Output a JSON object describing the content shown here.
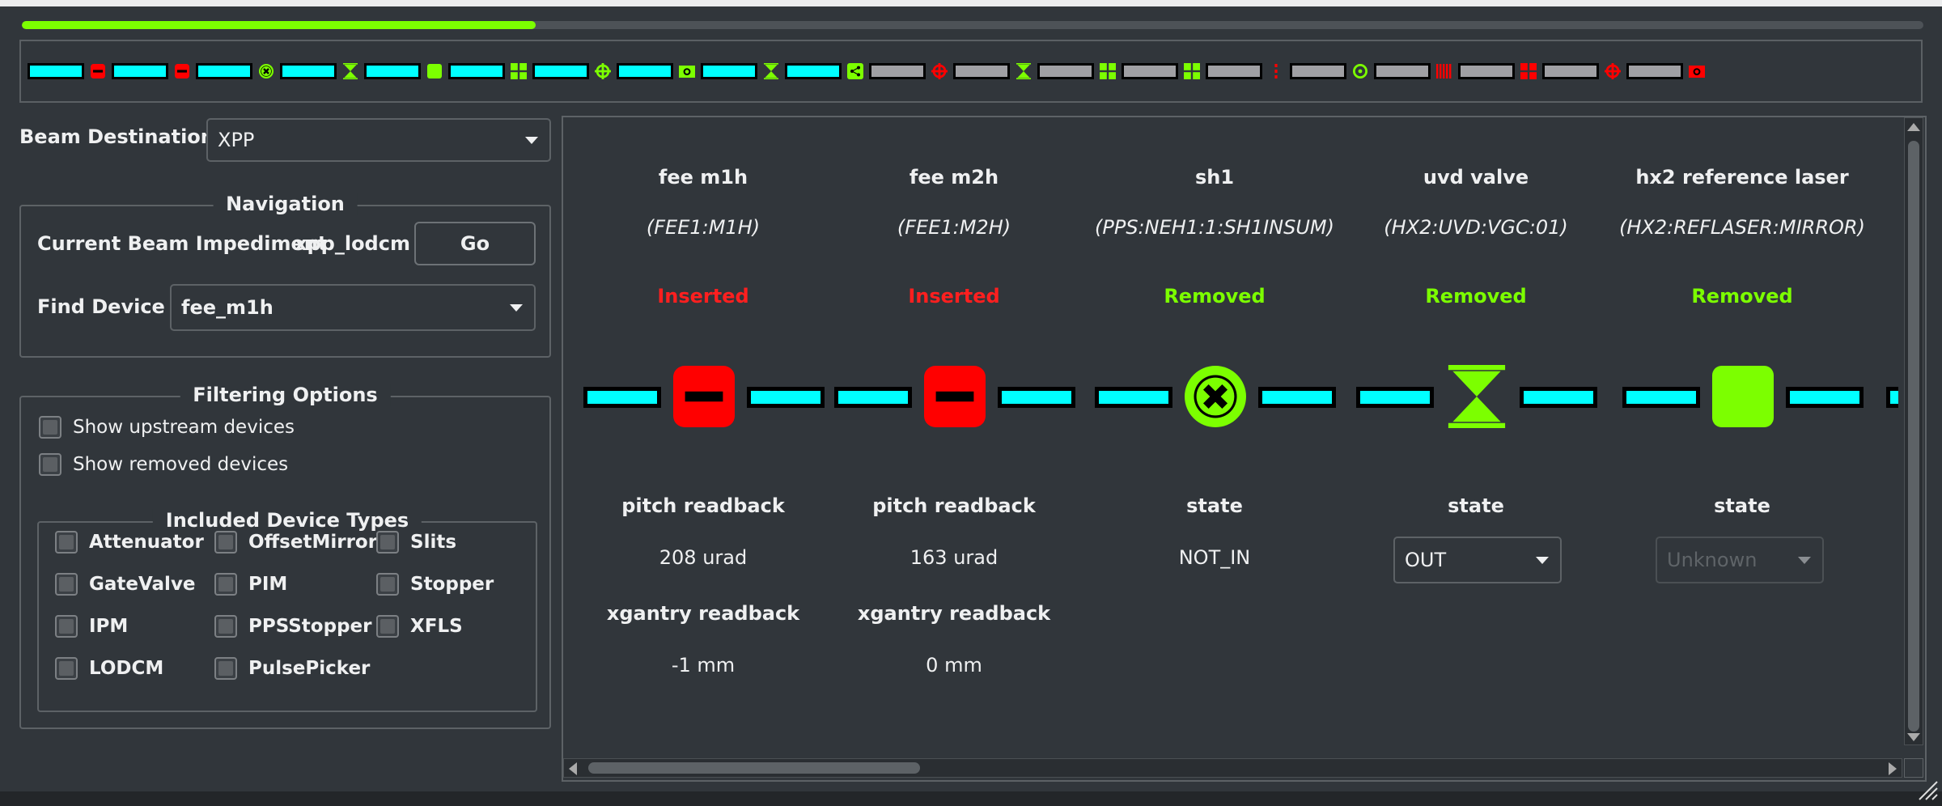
{
  "progress": {
    "value": 0.27
  },
  "colors": {
    "accent_green": "#7cff00",
    "inserted_red": "#ff0000",
    "beam_cyan": "#00ffff",
    "segment_grey": "#a0a0a4"
  },
  "overview": {
    "items": [
      {
        "seg": "cyan",
        "icon": "red-minus-icon"
      },
      {
        "seg": "cyan",
        "icon": "red-minus-icon"
      },
      {
        "seg": "cyan",
        "icon": "green-x-circle-icon"
      },
      {
        "seg": "cyan",
        "icon": "green-hourglass-icon"
      },
      {
        "seg": "cyan",
        "icon": "green-square-icon"
      },
      {
        "seg": "cyan",
        "icon": "green-grid-icon"
      },
      {
        "seg": "cyan",
        "icon": "green-target-icon"
      },
      {
        "seg": "cyan",
        "icon": "green-camera-icon"
      },
      {
        "seg": "cyan",
        "icon": "green-hourglass-icon"
      },
      {
        "seg": "cyan",
        "icon": "green-share-icon"
      },
      {
        "seg": "grey",
        "icon": "red-target-icon"
      },
      {
        "seg": "grey",
        "icon": "green-hourglass-icon"
      },
      {
        "seg": "grey",
        "icon": "green-grid-icon"
      },
      {
        "seg": "grey",
        "icon": "green-grid-icon"
      },
      {
        "seg": "grey",
        "icon": "red-dots-icon"
      },
      {
        "seg": "grey",
        "icon": "green-ring-icon"
      },
      {
        "seg": "grey",
        "icon": "red-bars-icon"
      },
      {
        "seg": "grey",
        "icon": "red-grid-icon"
      },
      {
        "seg": "grey",
        "icon": "red-target-icon"
      },
      {
        "seg": "grey",
        "icon": "red-camera-icon"
      }
    ]
  },
  "left": {
    "beam_destination_label": "Beam Destination",
    "beam_destination_value": "XPP",
    "navigation": {
      "title": "Navigation",
      "current_label": "Current Beam Impediment",
      "current_value": "xpp_lodcm",
      "go_label": "Go",
      "find_label": "Find Device",
      "find_value": "fee_m1h"
    },
    "filtering": {
      "title": "Filtering Options",
      "show_upstream": "Show upstream devices",
      "show_removed": "Show removed devices",
      "types_title": "Included Device Types",
      "types": [
        "Attenuator",
        "OffsetMirror",
        "Slits",
        "GateValve",
        "PIM",
        "Stopper",
        "IPM",
        "PPSStopper",
        "XFLS",
        "LODCM",
        "PulsePicker"
      ]
    }
  },
  "devices": [
    {
      "name": "fee m1h",
      "pv": "(FEE1:M1H)",
      "state": "Inserted",
      "state_color": "#ff1f1f",
      "icon": "red-minus-icon",
      "signals": [
        {
          "label": "pitch readback",
          "value": "208 urad"
        },
        {
          "label": "xgantry readback",
          "value": "-1 mm"
        }
      ]
    },
    {
      "name": "fee m2h",
      "pv": "(FEE1:M2H)",
      "state": "Inserted",
      "state_color": "#ff1f1f",
      "icon": "red-minus-icon",
      "signals": [
        {
          "label": "pitch readback",
          "value": "163 urad"
        },
        {
          "label": "xgantry readback",
          "value": "0 mm"
        }
      ]
    },
    {
      "name": "sh1",
      "pv": "(PPS:NEH1:1:SH1INSUM)",
      "state": "Removed",
      "state_color": "#7cff00",
      "icon": "green-x-circle-icon",
      "signals": [
        {
          "label": "state",
          "value": "NOT_IN"
        }
      ]
    },
    {
      "name": "uvd valve",
      "pv": "(HX2:UVD:VGC:01)",
      "state": "Removed",
      "state_color": "#7cff00",
      "icon": "green-hourglass-icon",
      "signals": [
        {
          "label": "state",
          "value": "OUT"
        }
      ]
    },
    {
      "name": "hx2 reference laser",
      "pv": "(HX2:REFLASER:MIRROR)",
      "state": "Removed",
      "state_color": "#7cff00",
      "icon": "green-square-icon",
      "signals": [
        {
          "label": "state",
          "value": "Unknown"
        }
      ]
    }
  ]
}
